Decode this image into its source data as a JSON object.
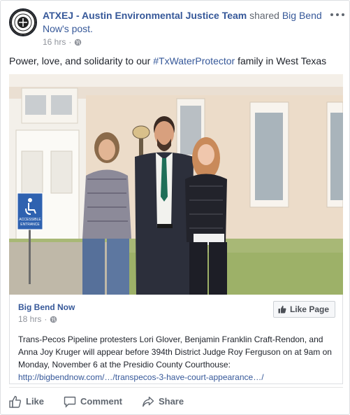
{
  "post": {
    "author": "ATXEJ - Austin Environmental Justice Team",
    "shared_word": " shared ",
    "shared_source": "Big Bend Now",
    "shared_suffix": "'s post.",
    "timestamp": "16 hrs",
    "dot": "·",
    "message_prefix": "Power, love, and solidarity to our ",
    "hashtag": "#TxWaterProtector",
    "message_suffix": " family in West Texas"
  },
  "photo": {
    "sign_line1": "ACCESSIBLE",
    "sign_line2": "ENTRANCE"
  },
  "attachment": {
    "page_name": "Big Bend Now",
    "timestamp": "18 hrs",
    "dot": "·",
    "like_page_label": "Like Page",
    "text": "Trans-Pecos Pipeline protesters Lori Glover, Benjamin Franklin Craft-Rendon, and Anna Joy Kruger will appear before 394th District Judge Roy Ferguson on at 9am on Monday, November 6 at the Presidio County Courthouse:",
    "link": "http://bigbendnow.com/…/transpecos-3-have-court-appearance…/"
  },
  "actions": {
    "like": "Like",
    "comment": "Comment",
    "share": "Share"
  },
  "colors": {
    "link": "#365899",
    "text": "#1d2129",
    "muted": "#90949c",
    "border": "#dddfe2"
  }
}
